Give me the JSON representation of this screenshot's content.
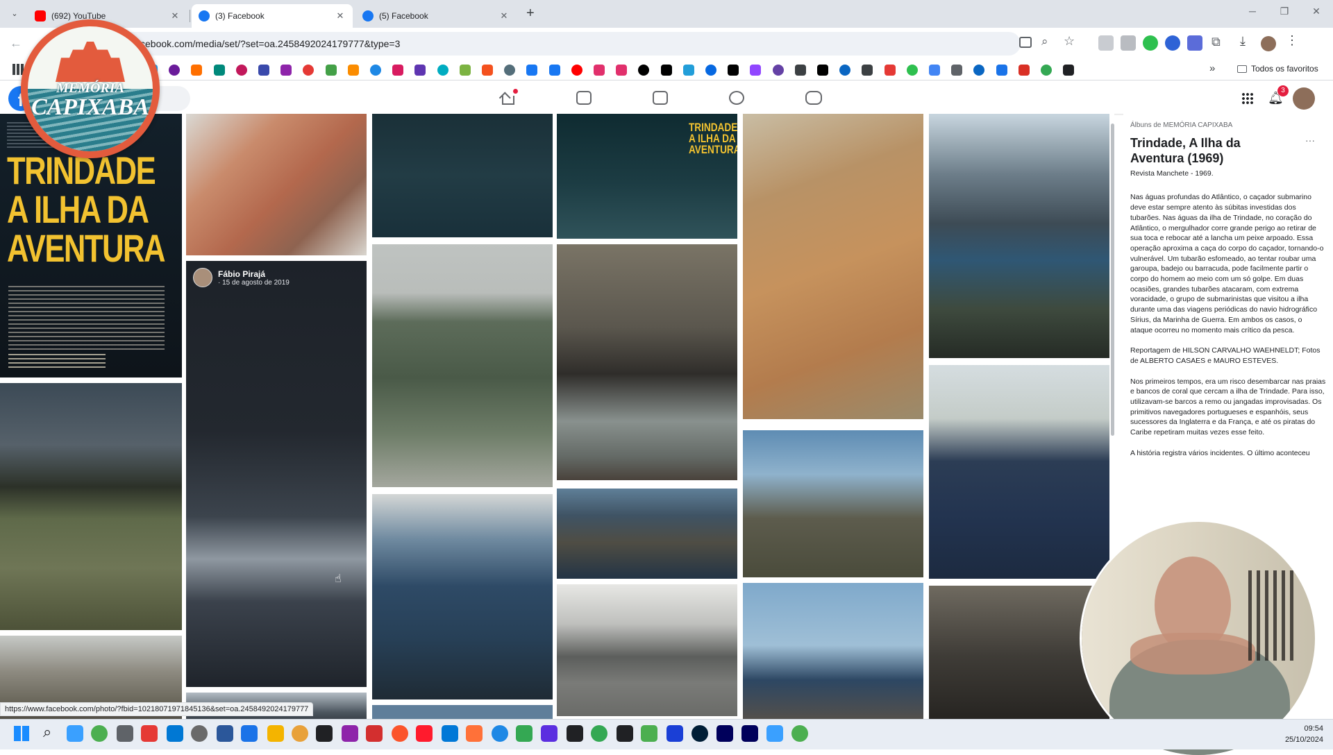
{
  "browser": {
    "tabs": [
      {
        "title": "(692) YouTube",
        "favicon": "youtube-icon",
        "active": false
      },
      {
        "title": "(3) Facebook",
        "favicon": "facebook-icon",
        "active": true
      },
      {
        "title": "(5) Facebook",
        "favicon": "facebook-icon",
        "active": false
      }
    ],
    "new_tab": "+",
    "url": "cebook.com/media/set/?set=oa.2458492024179777&type=3",
    "bookmarks_folder": "Todos os favoritos",
    "status_url": "https://www.facebook.com/photo/?fbid=10218071971845136&set=oa.2458492024179777"
  },
  "logo": {
    "top_text": "MEMÓRIA",
    "bottom_text": "CAPIXABA",
    "colors": {
      "ring": "#e35b3d",
      "inner": "#f4f7f2",
      "waves": "#2a7d8c"
    }
  },
  "facebook": {
    "notifications_count": "3",
    "photo_overlay": {
      "author": "Fábio Pirajá",
      "date": "· 15 de agosto de 2019"
    },
    "magazine_cover": {
      "headline1": "TRINDADE",
      "headline2": "A ILHA DA",
      "headline3": "AVENTURA"
    },
    "photo_cover_small": {
      "line1": "TRINDADE",
      "line2": "A ILHA DA",
      "line3": "AVENTURA"
    },
    "album": {
      "breadcrumb": "Álbuns de MEMÓRIA CAPIXABA",
      "title": "Trindade, A Ilha da Aventura (1969)",
      "subtitle": "Revista Manchete - 1969.",
      "more": "···",
      "paragraphs": [
        "Nas águas profundas do Atlântico, o caçador submarino deve estar sempre atento às súbitas investidas dos tubarões. Nas águas da ilha de Trindade, no coração do Atlântico, o mergulhador corre grande perigo ao retirar de sua toca e rebocar até a lancha um peixe arpoado. Essa operação aproxima a caça do corpo do caçador, tornando-o vulnerável. Um tubarão esfomeado, ao tentar roubar uma garoupa, badejo ou barracuda, pode facilmente partir o corpo do homem ao meio com um só golpe. Em duas ocasiões, grandes tubarões atacaram, com extrema voracidade, o grupo de submarinistas que visitou a ilha durante uma das viagens periódicas do navio hidrográfico Sírius, da Marinha de Guerra. Em ambos os casos, o ataque ocorreu no momento mais crítico da pesca.",
        "Reportagem de HILSON CARVALHO WAEHNELDT; Fotos de ALBERTO CASAES e MAURO ESTEVES.",
        "Nos primeiros tempos, era um risco desembarcar nas praias e bancos de coral que cercam a ilha de Trindade. Para isso, utilizavam-se barcos a remo ou jangadas improvisadas. Os primitivos navegadores portugueses e espanhóis, seus sucessores da Inglaterra e da França, e até os piratas do Caribe repetiram muitas vezes esse feito.",
        "A história registra vários incidentes. O último aconteceu"
      ]
    }
  },
  "taskbar": {
    "time": "09:54",
    "date": "25/10/2024"
  }
}
